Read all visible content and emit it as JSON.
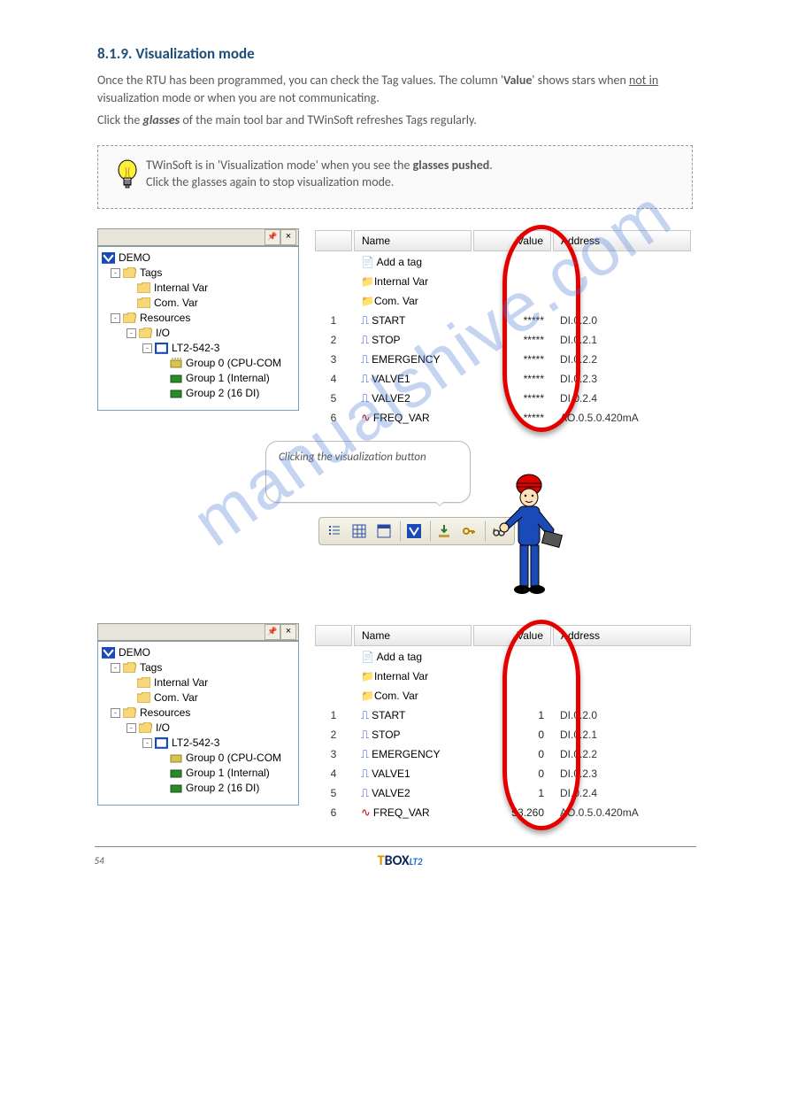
{
  "header": {
    "title": "8.1.9. Visualization mode"
  },
  "para": {
    "sentence1_a": "Once the RTU has been programmed, you can check the Tag values.  The column ",
    "sentence1_b": "Value",
    "sentence1_c": " shows stars when ",
    "sentence1_d": "not in",
    "sentence1_e": " visualization mode or when you are not communicating.",
    "sentence2_a": "Click the ",
    "sentence2_b": "glasses",
    "sentence2_c": " of the main tool bar and TWinSoft refreshes Tags regularly."
  },
  "tip": {
    "line1": "TWinSoft is in 'Visualization mode' when you see the ",
    "bold": "glasses pushed",
    "line2": "Click the glasses again to stop visualization mode."
  },
  "tree": {
    "root": "DEMO",
    "nodes": {
      "tags": "Tags",
      "internalVar": "Internal Var",
      "comVar": "Com. Var",
      "resources": "Resources",
      "io": "I/O",
      "device": "LT2-542-3",
      "group0": "Group 0 (CPU-COM",
      "group1": "Group 1 (Internal)",
      "group2": "Group 2 (16 DI)"
    }
  },
  "table": {
    "headers": {
      "name": "Name",
      "value": "Value",
      "address": "Address"
    },
    "folders": {
      "add": "Add a tag",
      "internal": "Internal Var",
      "com": "Com. Var"
    },
    "starRows": [
      {
        "idx": "1",
        "name": "START",
        "value": "*****",
        "address": "DI.0.2.0"
      },
      {
        "idx": "2",
        "name": "STOP",
        "value": "*****",
        "address": "DI.0.2.1"
      },
      {
        "idx": "3",
        "name": "EMERGENCY",
        "value": "*****",
        "address": "DI.0.2.2"
      },
      {
        "idx": "4",
        "name": "VALVE1",
        "value": "*****",
        "address": "DI.0.2.3"
      },
      {
        "idx": "5",
        "name": "VALVE2",
        "value": "*****",
        "address": "DI.0.2.4"
      },
      {
        "idx": "6",
        "name": "FREQ_VAR",
        "value": "*****",
        "address": "AO.0.5.0.420mA",
        "analog": true
      }
    ],
    "valRows": [
      {
        "idx": "1",
        "name": "START",
        "value": "1",
        "address": "DI.0.2.0"
      },
      {
        "idx": "2",
        "name": "STOP",
        "value": "0",
        "address": "DI.0.2.1"
      },
      {
        "idx": "3",
        "name": "EMERGENCY",
        "value": "0",
        "address": "DI.0.2.2"
      },
      {
        "idx": "4",
        "name": "VALVE1",
        "value": "0",
        "address": "DI.0.2.3"
      },
      {
        "idx": "5",
        "name": "VALVE2",
        "value": "1",
        "address": "DI.0.2.4"
      },
      {
        "idx": "6",
        "name": "FREQ_VAR",
        "value": "53.260",
        "address": "AO.0.5.0.420mA",
        "analog": true
      }
    ]
  },
  "speech": {
    "text": "Clicking the visualization button"
  },
  "footer": {
    "left": "54",
    "logoT": "T",
    "logoBox": "BOX",
    "logoLt": "LT2",
    "right": ""
  },
  "watermark": "manualshive.com"
}
